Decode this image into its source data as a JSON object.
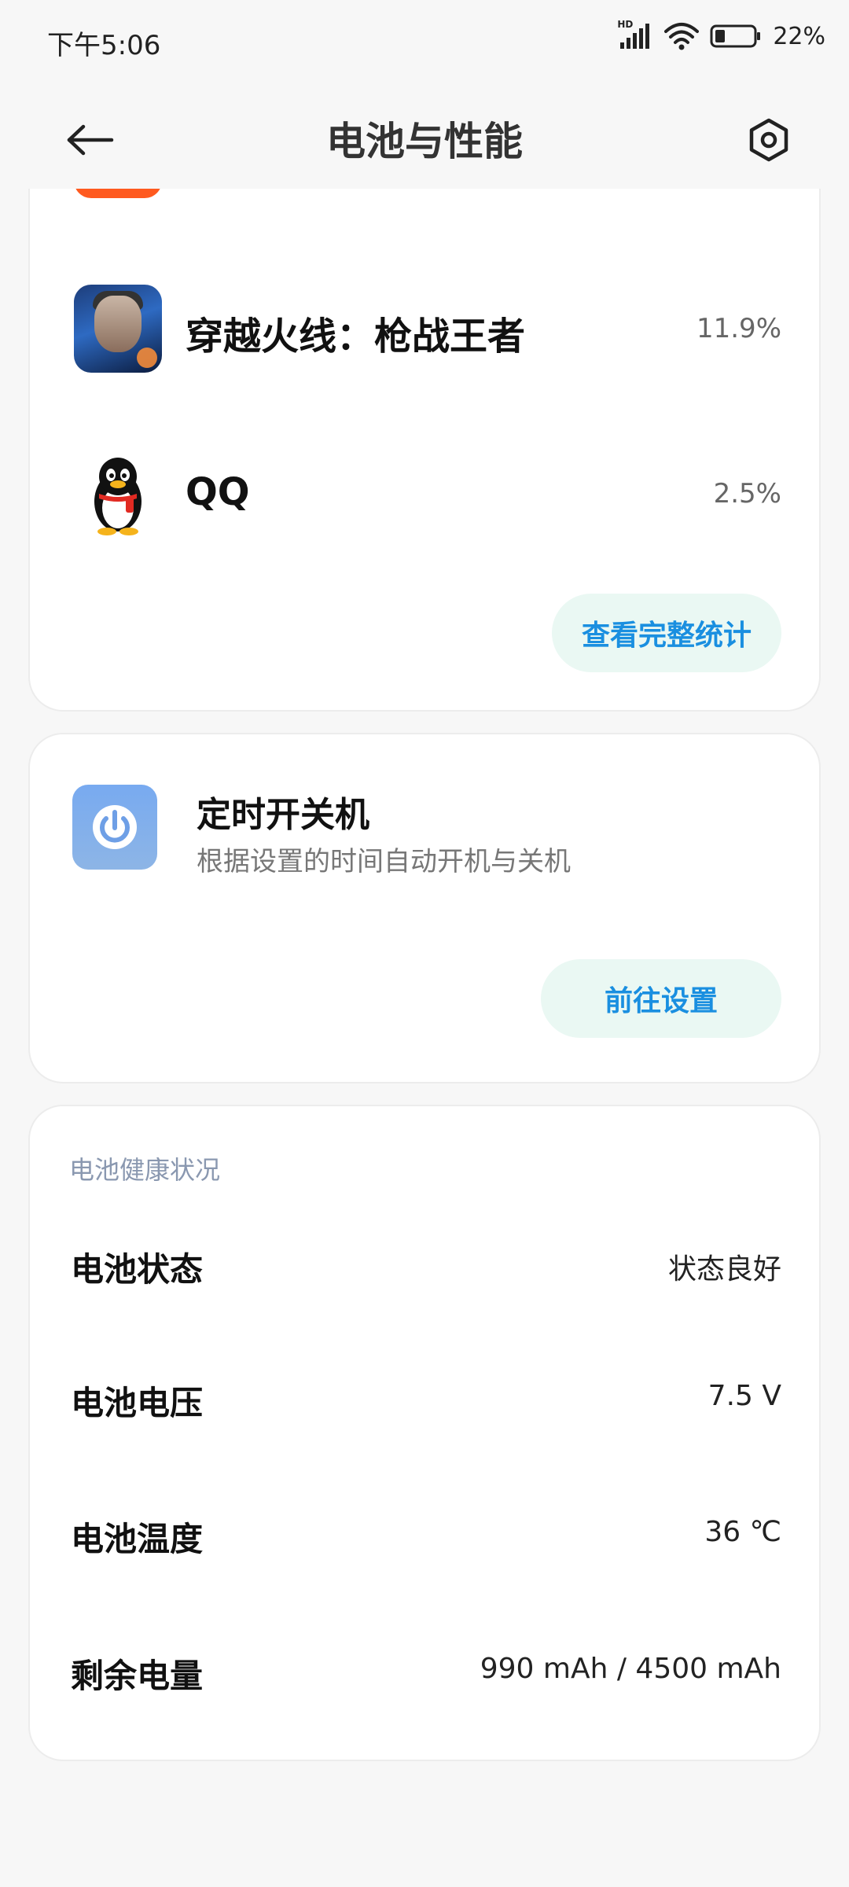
{
  "status_bar": {
    "time": "下午5:06",
    "network_label": "HD",
    "battery_percent": "22%"
  },
  "header": {
    "title": "电池与性能"
  },
  "app_usage": {
    "apps": [
      {
        "name": "穿越火线：枪战王者",
        "percent": "11.9%",
        "icon": "crossfire-app-icon"
      },
      {
        "name": "QQ",
        "percent": "2.5%",
        "icon": "qq-penguin-icon"
      }
    ],
    "view_full_label": "查看完整统计"
  },
  "scheduled_power": {
    "title": "定时开关机",
    "subtitle": "根据设置的时间自动开机与关机",
    "button_label": "前往设置"
  },
  "battery_health": {
    "section_label": "电池健康状况",
    "rows": [
      {
        "label": "电池状态",
        "value": "状态良好"
      },
      {
        "label": "电池电压",
        "value": "7.5 V"
      },
      {
        "label": "电池温度",
        "value": "36 ℃"
      },
      {
        "label": "剩余电量",
        "value": "990 mAh / 4500 mAh"
      }
    ]
  },
  "colors": {
    "accent": "#1a8fe0",
    "pill_bg": "#eaf8f3",
    "background": "#f7f7f7"
  }
}
